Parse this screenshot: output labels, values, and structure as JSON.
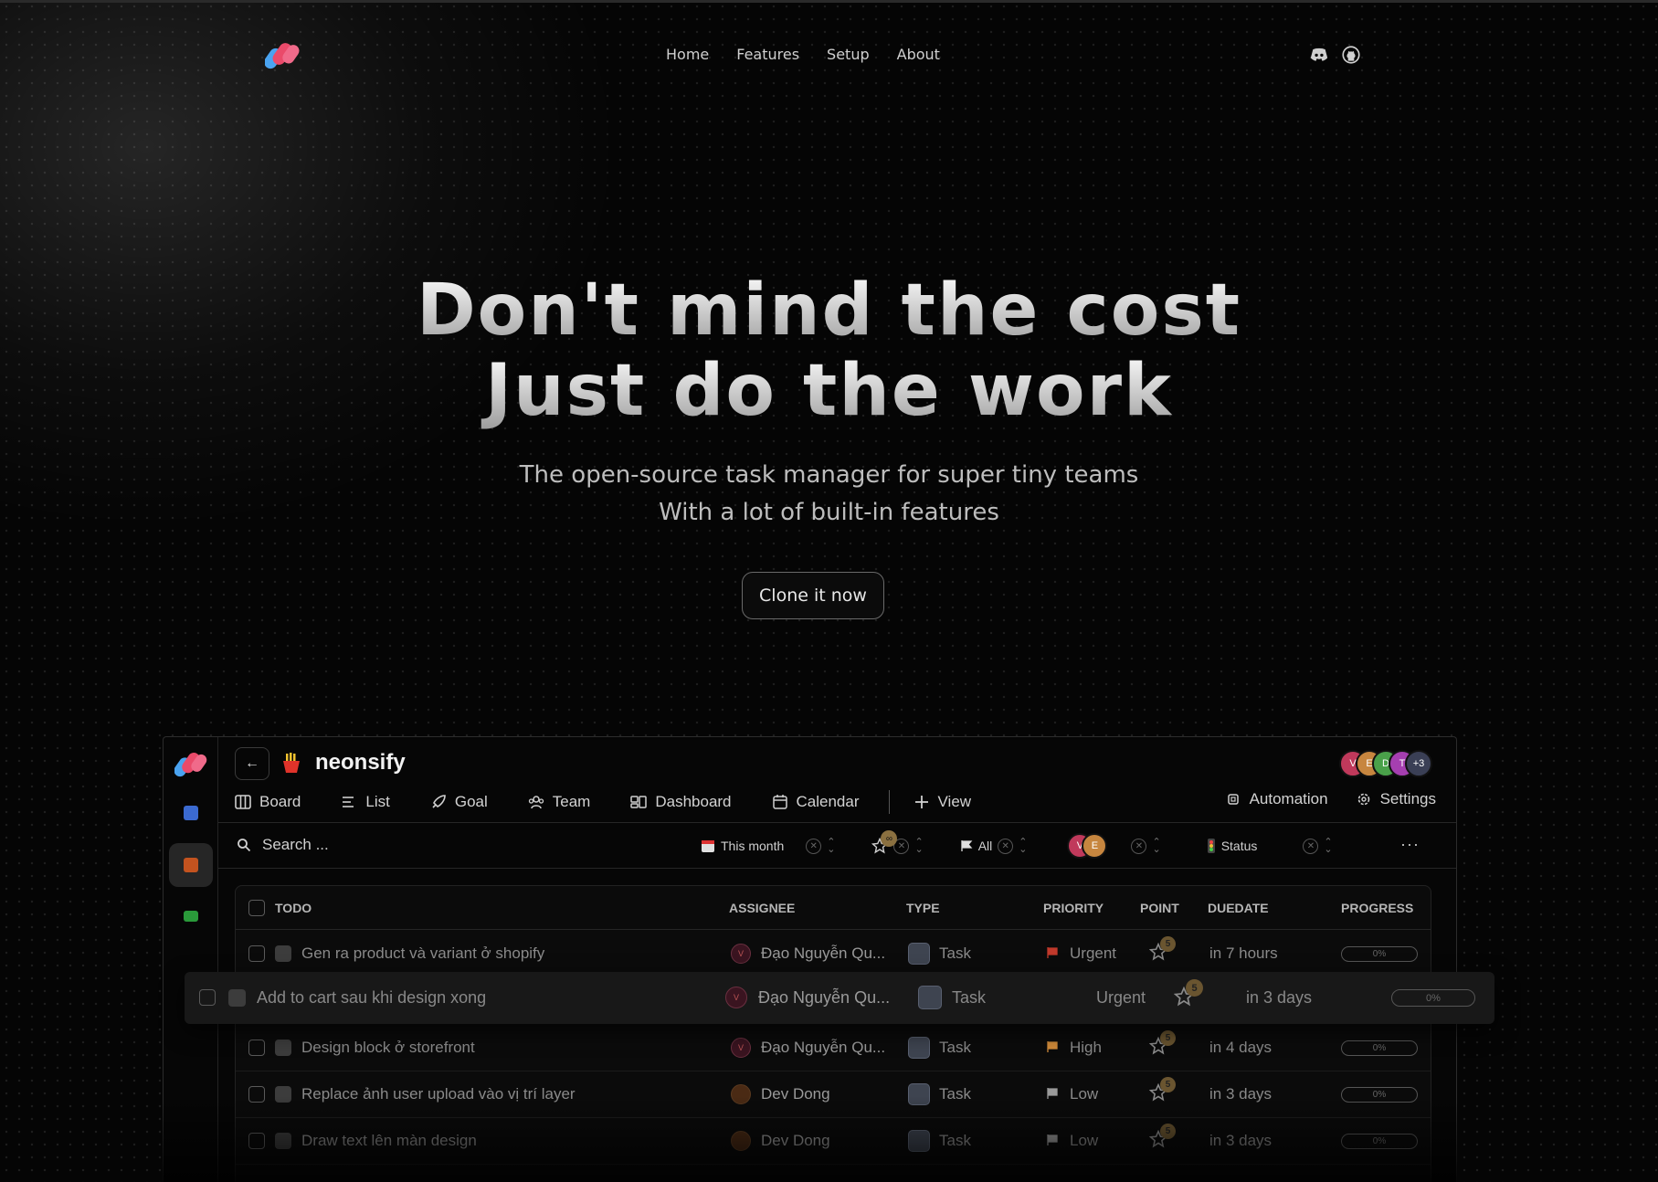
{
  "nav": {
    "links": [
      "Home",
      "Features",
      "Setup",
      "About"
    ],
    "social": [
      "discord-icon",
      "github-icon"
    ]
  },
  "hero": {
    "line1": "Don't mind the cost",
    "line2": "Just do the work",
    "sub1": "The open-source task manager for super tiny teams",
    "sub2": "With a lot of built-in features",
    "cta": "Clone it now"
  },
  "app": {
    "project": "neonsify",
    "project_icon": "fries-icon",
    "avatars": [
      {
        "letter": "V",
        "color": "#c0395b"
      },
      {
        "letter": "E",
        "color": "#c7863f"
      },
      {
        "letter": "D",
        "color": "#4aa14a"
      },
      {
        "letter": "T",
        "color": "#a53fb0"
      },
      {
        "letter": "+3",
        "color": "#3a3f55"
      }
    ],
    "tabs": [
      "Board",
      "List",
      "Goal",
      "Team",
      "Dashboard",
      "Calendar",
      "View"
    ],
    "right_tabs": [
      "Automation",
      "Settings"
    ],
    "search_placeholder": "Search ...",
    "filters": {
      "date": "This month",
      "points": "∞",
      "priority": "All",
      "status": "Status"
    },
    "columns": [
      "TODO",
      "ASSIGNEE",
      "TYPE",
      "PRIORITY",
      "POINT",
      "DUEDATE",
      "PROGRESS"
    ],
    "rows": [
      {
        "name": "Gen ra product và variant ở shopify",
        "assignee": "Đạo Nguyễn Qu...",
        "initial": "V",
        "type": "Task",
        "priority": "Urgent",
        "flag": "#c0392b",
        "point": "5",
        "due": "in 7 hours",
        "progress": "0%"
      },
      {
        "name": "Add to cart sau khi design xong",
        "assignee": "Đạo Nguyễn Qu...",
        "initial": "V",
        "type": "Task",
        "priority": "Urgent",
        "flag": "#c0392b",
        "point": "5",
        "due": "in 3 days",
        "progress": "0%"
      },
      {
        "name": "Design block ở storefront",
        "assignee": "Đạo Nguyễn Qu...",
        "initial": "V",
        "type": "Task",
        "priority": "High",
        "flag": "#d08a3a",
        "point": "5",
        "due": "in 4 days",
        "progress": "0%"
      },
      {
        "name": "Replace ảnh user upload vào vị trí layer",
        "assignee": "Dev Dong",
        "initial": "",
        "type": "Task",
        "priority": "Low",
        "flag": "#9a9a9a",
        "point": "5",
        "due": "in 3 days",
        "progress": "0%"
      },
      {
        "name": "Draw text lên màn design",
        "assignee": "Dev Dong",
        "initial": "",
        "type": "Task",
        "priority": "Low",
        "flag": "#9a9a9a",
        "point": "5",
        "due": "in 3 days",
        "progress": "0%"
      }
    ]
  }
}
